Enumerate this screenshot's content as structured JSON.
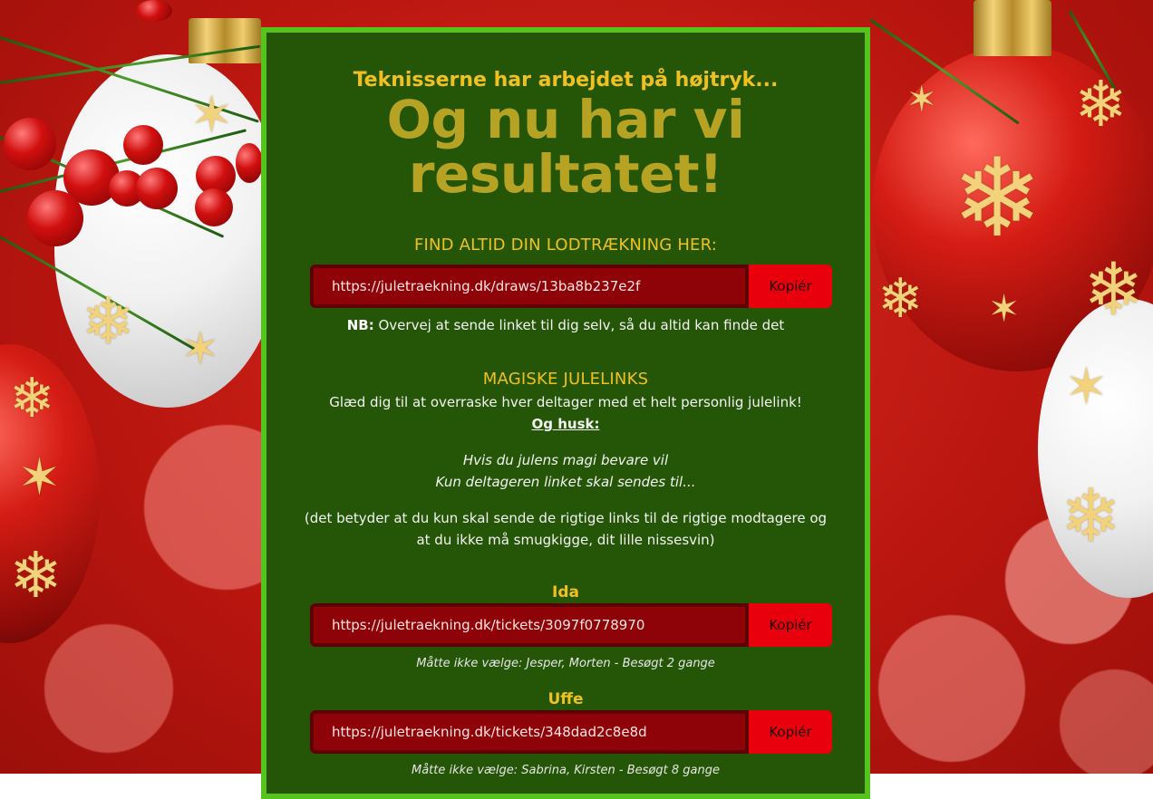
{
  "colors": {
    "card_bg": "#255608",
    "card_border": "#55c21d",
    "accent_gold": "#f0c020",
    "headline_olive": "#b6a324",
    "link_bg": "#8e0307",
    "copy_button_bg": "#e8000d",
    "page_bg_red": "#c21a12"
  },
  "header": {
    "eyebrow": "Teknisserne har arbejdet på højtryk...",
    "headline_line1": "Og nu har vi",
    "headline_line2": "resultatet!"
  },
  "draw_link": {
    "title": "FIND ALTID DIN LODTRÆKNING HER:",
    "url": "https://juletraekning.dk/draws/13ba8b237e2f",
    "copy_label": "Kopiér",
    "note_bold": "NB:",
    "note_text": " Overvej at sende linket til dig selv, så du altid kan finde det"
  },
  "magic": {
    "title": "MAGISKE JULELINKS",
    "intro": "Glæd dig til at overraske hver deltager med et helt personlig julelink!",
    "remember": "Og husk:",
    "verse_line1": "Hvis du julens magi bevare vil",
    "verse_line2": "Kun deltageren linket skal sendes til...",
    "explain_line1": "(det betyder at du kun skal sende de rigtige links til de rigtige modtagere og",
    "explain_line2": "at du ikke må smugkigge, dit lille nissesvin)"
  },
  "participants": [
    {
      "name": "Ida",
      "url": "https://juletraekning.dk/tickets/3097f0778970",
      "copy_label": "Kopiér",
      "meta": "Måtte ikke vælge: Jesper, Morten - Besøgt 2 gange"
    },
    {
      "name": "Uffe",
      "url": "https://juletraekning.dk/tickets/348dad2c8e8d",
      "copy_label": "Kopiér",
      "meta": "Måtte ikke vælge: Sabrina, Kirsten - Besøgt 8 gange"
    }
  ],
  "icons": [
    "snowflake-icon",
    "christmas-bauble-icon",
    "holly-berry-icon"
  ]
}
